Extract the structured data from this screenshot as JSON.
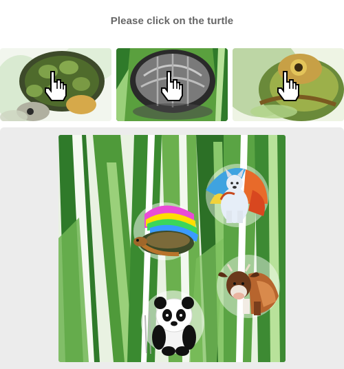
{
  "challenge": {
    "prompt": "Please click on the turtle"
  },
  "examples": [
    {
      "subject": "turtle",
      "icon": "pointer-hand-icon"
    },
    {
      "subject": "turtle",
      "icon": "pointer-hand-icon"
    },
    {
      "subject": "turtle",
      "icon": "pointer-hand-icon"
    }
  ],
  "canvas_items": [
    {
      "subject": "turtle"
    },
    {
      "subject": "dog"
    },
    {
      "subject": "cow"
    },
    {
      "subject": "panda"
    }
  ],
  "colors": {
    "prompt_text": "#666666",
    "panel_bg": "#ececec",
    "leaf_dark": "#2f7a2a",
    "leaf_light": "#8fcf6a"
  }
}
